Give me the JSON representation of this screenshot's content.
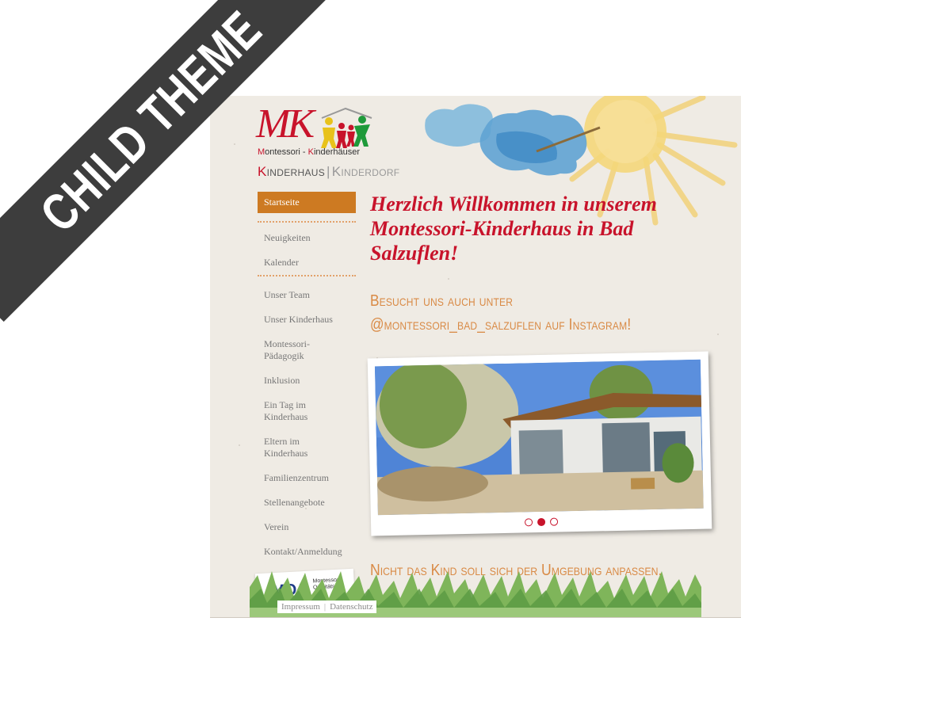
{
  "ribbon": {
    "label": "CHILD THEME"
  },
  "logo": {
    "mark": "MK",
    "tagline_m": "M",
    "tagline_rest1": "ontessori - ",
    "tagline_k": "K",
    "tagline_rest2": "inderhäuser",
    "sub_k": "K",
    "sub_rest": "inderhaus",
    "sub_divider": "|",
    "sub_second": "Kinderdorf"
  },
  "nav": {
    "active": "Startseite",
    "group1": [
      "Neuigkeiten",
      "Kalender"
    ],
    "group2": [
      "Unser Team",
      "Unser Kinderhaus",
      "Montessori-\nPädagogik",
      "Inklusion",
      "Ein Tag im\nKinderhaus",
      "Eltern im\nKinderhaus",
      "Familienzentrum",
      "Stellenangebote",
      "Verein",
      "Kontakt/Anmeldung"
    ]
  },
  "mqa": {
    "logo": "MQA",
    "text": "Montessori\nQualitäts"
  },
  "main": {
    "welcome": "Herzlich Willkommen in unserem Montessori-Kinderhaus in Bad Salzuflen!",
    "insta_line1": "Besucht uns auch unter",
    "insta_line2": "@montessori_bad_salzuflen auf Instagram!",
    "quote": "Nicht das Kind soll sich der Umgebung anpassen,"
  },
  "slider": {
    "active_index": 1,
    "count": 3
  },
  "footer": {
    "impressum": "Impressum",
    "divider": "|",
    "datenschutz": "Datenschutz"
  },
  "colors": {
    "brand_red": "#c8132b",
    "accent_orange": "#cd7a22",
    "insta_orange": "#d98a45",
    "paper": "#efebe4"
  }
}
